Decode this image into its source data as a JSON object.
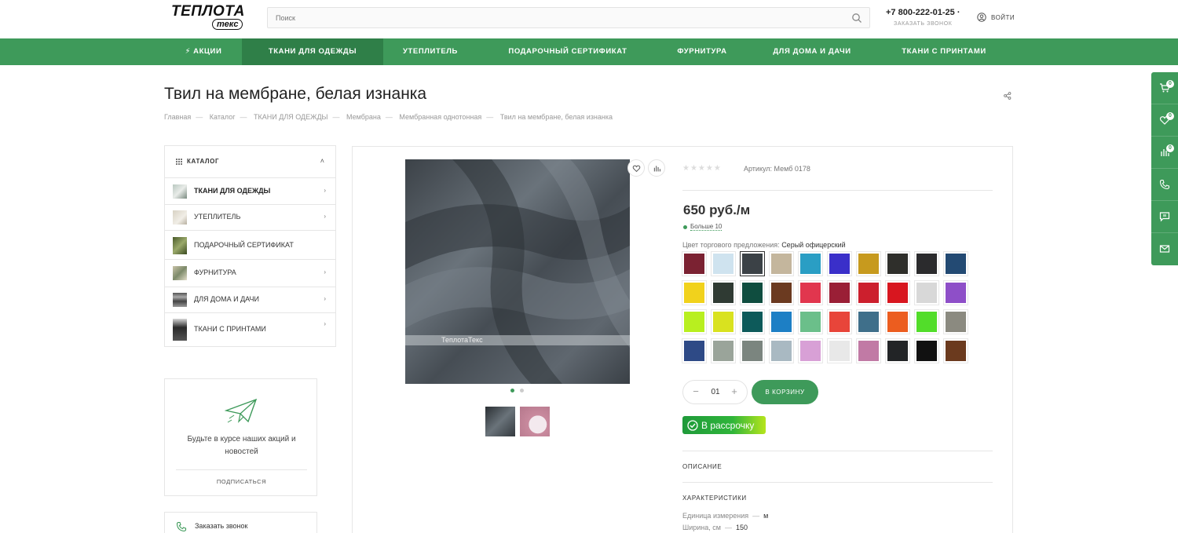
{
  "header": {
    "logo_top": "ТЕПЛОТА",
    "logo_bottom": "текс",
    "search_placeholder": "Поиск",
    "phone": "+7 800-222-01-25 ·",
    "callback": "ЗАКАЗАТЬ ЗВОНОК",
    "login": "ВОЙТИ"
  },
  "nav": {
    "items": [
      {
        "label": "⚡ АКЦИИ"
      },
      {
        "label": "ТКАНИ ДЛЯ ОДЕЖДЫ"
      },
      {
        "label": "УТЕПЛИТЕЛЬ"
      },
      {
        "label": "ПОДАРОЧНЫЙ СЕРТИФИКАТ"
      },
      {
        "label": "ФУРНИТУРА"
      },
      {
        "label": "ДЛЯ ДОМА И ДАЧИ"
      },
      {
        "label": "ТКАНИ С ПРИНТАМИ"
      }
    ],
    "active_index": 1
  },
  "side_tools": {
    "cart_count": "0",
    "fav_count": "0",
    "compare_count": "0"
  },
  "page": {
    "title": "Твил на мембране, белая изнанка",
    "breadcrumbs": [
      "Главная",
      "Каталог",
      "ТКАНИ ДЛЯ ОДЕЖДЫ",
      "Мембрана",
      "Мембранная однотонная",
      "Твил на мембране, белая изнанка"
    ]
  },
  "catalog": {
    "title": "КАТАЛОГ",
    "items": [
      {
        "label": "ТКАНИ ДЛЯ ОДЕЖДЫ",
        "has_arrow": true
      },
      {
        "label": "УТЕПЛИТЕЛЬ",
        "has_arrow": true
      },
      {
        "label": "ПОДАРОЧНЫЙ СЕРТИФИКАТ",
        "has_arrow": false
      },
      {
        "label": "ФУРНИТУРА",
        "has_arrow": true
      },
      {
        "label": "ДЛЯ ДОМА И ДАЧИ",
        "has_arrow": true
      },
      {
        "label": "ТКАНИ С ПРИНТАМИ",
        "has_arrow": true
      }
    ]
  },
  "subscribe": {
    "text": "Будьте в курсе наших акций и новостей",
    "button": "ПОДПИСАТЬСЯ"
  },
  "callback_box": {
    "label": "Заказать звонок"
  },
  "product": {
    "watermark": "ТеплотаТекс",
    "sku": "Артикул: Мемб 0178",
    "price": "650 руб./м",
    "stock": "Больше 10",
    "color_label": "Цвет торгового предложения:",
    "color_value": "Серый офицерский",
    "swatch_colors": [
      [
        "#7b2232",
        "#cfe3ef",
        "#3b4146",
        "#c4b69d",
        "#2a9ec4",
        "#3a2fc9",
        "#c79a1e",
        "#2f2f2b",
        "#2b2b2d",
        "#234a73"
      ],
      [
        "#f1d21c",
        "#2f3a33",
        "#0f4d3f",
        "#6b3a20",
        "#e1364e",
        "#9a1f36",
        "#cc1f2d",
        "#d8161f",
        "#d8d8d8",
        "#8e4fc8"
      ],
      [
        "#b8ef1f",
        "#d9e21f",
        "#0d5a5a",
        "#1d7fc5",
        "#6bbf8a",
        "#e8453a",
        "#3f6f8a",
        "#ec5d1f",
        "#52dd2a",
        "#8b8a80"
      ],
      [
        "#2e4a86",
        "#9aa49a",
        "#7b857f",
        "#a9b9c2",
        "#d8a0d6",
        "#e8e8e8",
        "#c17aa5",
        "#222426",
        "#111111",
        "#6b3a1e"
      ]
    ],
    "selected_swatch": [
      0,
      2
    ],
    "quantity": "01",
    "cart_button": "В КОРЗИНУ",
    "credit": "В рассрочку",
    "description_label": "ОПИСАНИЕ",
    "characteristics_label": "ХАРАКТЕРИСТИКИ",
    "specs": [
      {
        "name": "Единица измерения",
        "value": "м"
      },
      {
        "name": "Ширина, см",
        "value": "150"
      }
    ]
  }
}
